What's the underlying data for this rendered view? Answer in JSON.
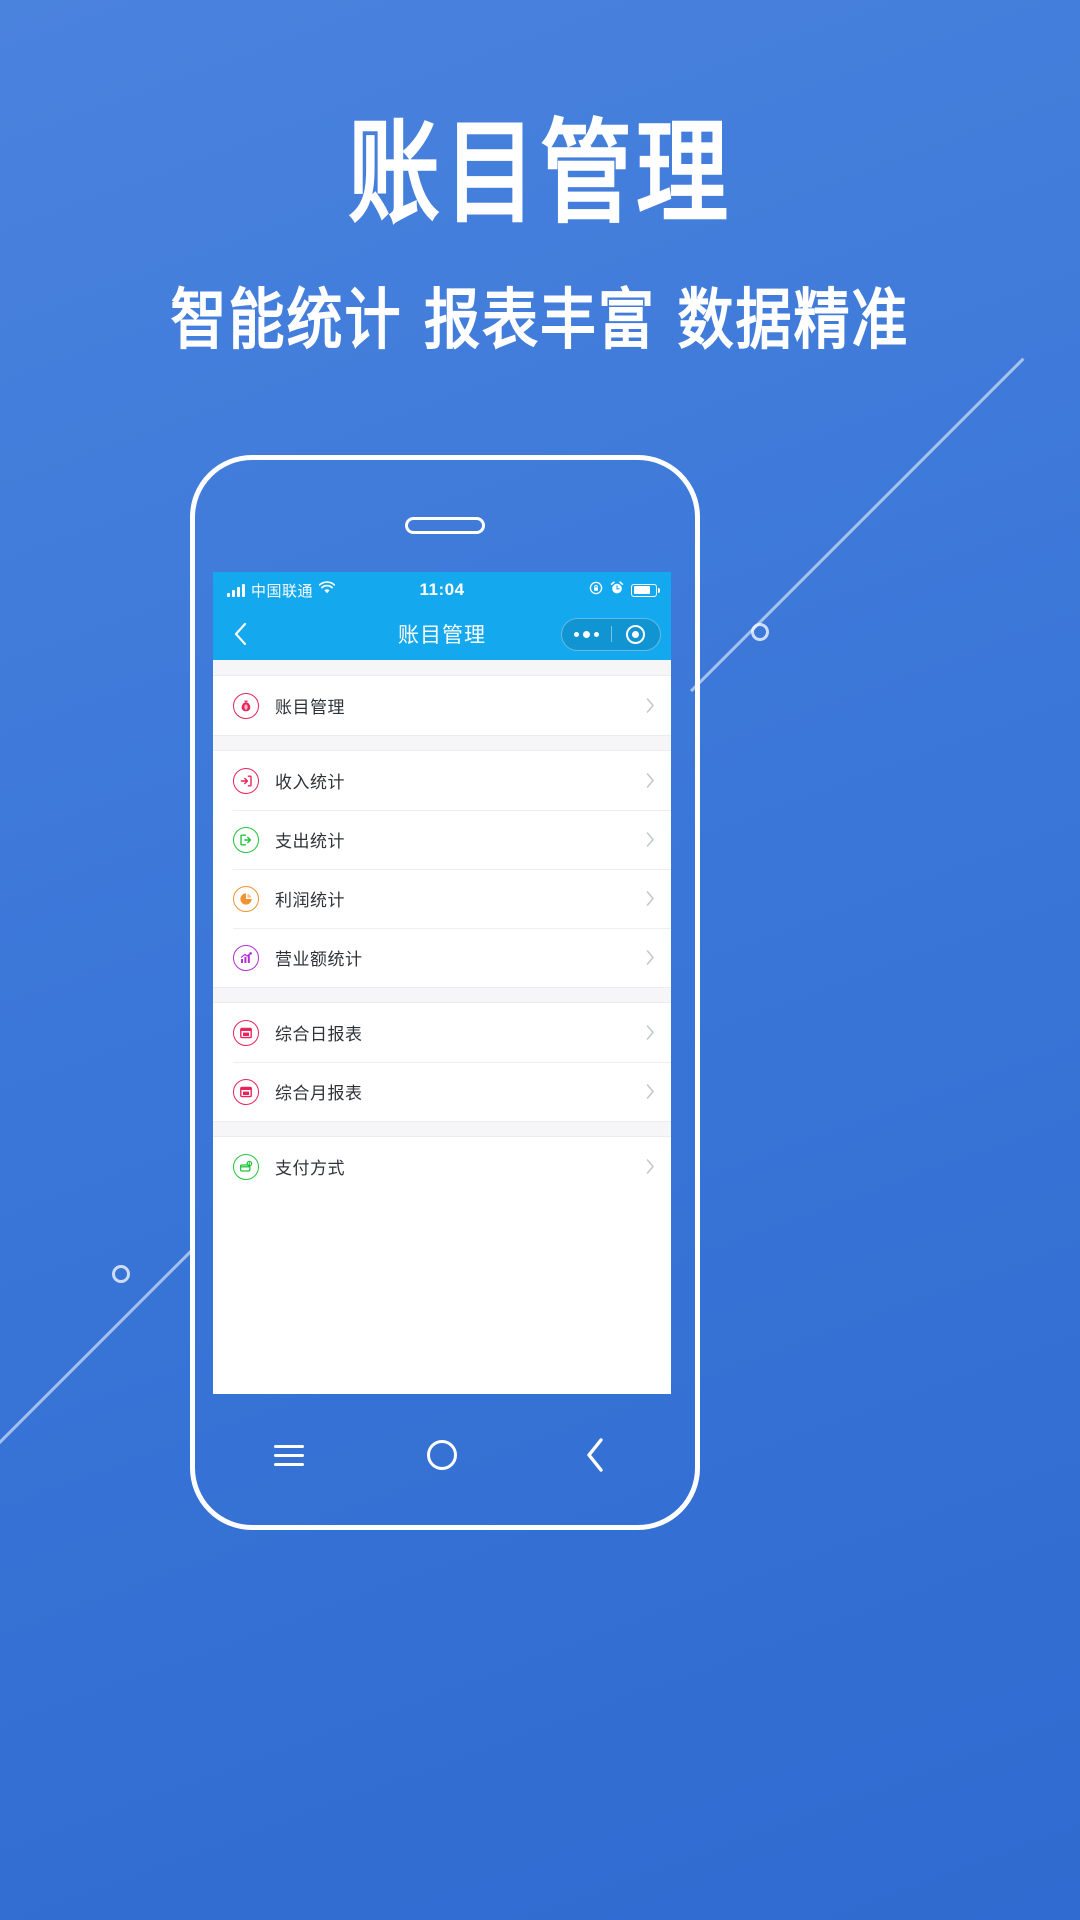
{
  "theme": {
    "background_blue": "#3b77d8",
    "header_blue": "#14a9ef",
    "pink": "#e8245a",
    "green": "#22c43c",
    "orange": "#f29232",
    "purple": "#b32fd6",
    "text_dark": "#2f3338",
    "chevron_gray": "#c2c6cb"
  },
  "hero": {
    "title": "账目管理",
    "subtitle": "智能统计 报表丰富 数据精准"
  },
  "phone": {
    "status_bar": {
      "carrier": "中国联通",
      "signal_icon": "signal-bars-icon",
      "wifi_icon": "wifi-icon",
      "time": "11:04",
      "rotation_lock_icon": "rotation-lock-icon",
      "alarm_icon": "alarm-clock-icon",
      "battery_icon": "battery-icon"
    },
    "nav_bar": {
      "back_icon": "chevron-left-icon",
      "title": "账目管理",
      "capsule": {
        "more_icon": "more-dots-icon",
        "target_icon": "target-circle-icon"
      }
    },
    "menu_groups": [
      {
        "items": [
          {
            "label": "账目管理",
            "icon": "money-bag-icon",
            "color": "#e8245a",
            "chevron": "chevron-right-icon"
          }
        ]
      },
      {
        "items": [
          {
            "label": "收入统计",
            "icon": "income-arrow-icon",
            "color": "#e8245a",
            "chevron": "chevron-right-icon"
          },
          {
            "label": "支出统计",
            "icon": "expense-arrow-icon",
            "color": "#22c43c",
            "chevron": "chevron-right-icon"
          },
          {
            "label": "利润统计",
            "icon": "pie-chart-icon",
            "color": "#f29232",
            "chevron": "chevron-right-icon"
          },
          {
            "label": "营业额统计",
            "icon": "trend-chart-icon",
            "color": "#b32fd6",
            "chevron": "chevron-right-icon"
          }
        ]
      },
      {
        "items": [
          {
            "label": "综合日报表",
            "icon": "report-day-icon",
            "color": "#e8245a",
            "chevron": "chevron-right-icon"
          },
          {
            "label": "综合月报表",
            "icon": "report-month-icon",
            "color": "#e8245a",
            "chevron": "chevron-right-icon"
          }
        ]
      },
      {
        "items": [
          {
            "label": "支付方式",
            "icon": "wallet-icon",
            "color": "#22c43c",
            "chevron": "chevron-right-icon"
          }
        ]
      }
    ],
    "android_nav": {
      "menu_icon": "hamburger-menu-icon",
      "home_icon": "home-circle-icon",
      "back_icon": "chevron-left-icon"
    }
  }
}
